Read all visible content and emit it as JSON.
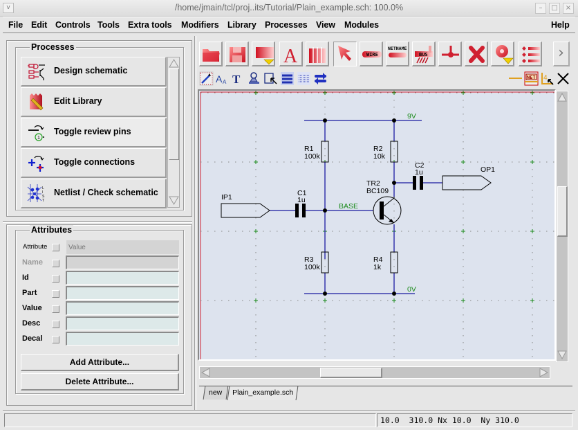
{
  "window": {
    "title": "/home/jmain/tcl/proj..its/Tutorial/Plain_example.sch: 100.0%",
    "menu_glyph": "v",
    "minimize": "–",
    "maximize": "□",
    "close": "×"
  },
  "menubar": {
    "items": [
      "File",
      "Edit",
      "Controls",
      "Tools",
      "Extra tools",
      "Modifiers",
      "Library",
      "Processes",
      "View",
      "Modules"
    ],
    "help": "Help"
  },
  "processes": {
    "title": "Processes",
    "items": [
      {
        "label": "Design schematic",
        "icon": "schematic-icon"
      },
      {
        "label": "Edit Library",
        "icon": "library-edit-icon"
      },
      {
        "label": "Toggle review pins",
        "icon": "review-pins-icon"
      },
      {
        "label": "Toggle connections",
        "icon": "connections-icon"
      },
      {
        "label": "Netlist / Check schematic",
        "icon": "netlist-icon"
      }
    ]
  },
  "attributes": {
    "title": "Attributes",
    "header_label": "Attribute",
    "header_value_placeholder": "Value",
    "rows": [
      {
        "label": "Name",
        "value": "",
        "enabled": false
      },
      {
        "label": "Id",
        "value": "",
        "enabled": true
      },
      {
        "label": "Part",
        "value": "",
        "enabled": true
      },
      {
        "label": "Value",
        "value": "",
        "enabled": true
      },
      {
        "label": "Desc",
        "value": "",
        "enabled": true
      },
      {
        "label": "Decal",
        "value": "",
        "enabled": true
      }
    ],
    "add_button": "Add Attribute...",
    "delete_button": "Delete Attribute..."
  },
  "toolbar": {
    "main_tools": [
      "open-icon",
      "save-icon",
      "place-component-icon",
      "text-icon",
      "library-icon",
      "select-pointer-icon",
      "wire-icon",
      "netname-icon",
      "bus-icon",
      "junction-icon",
      "delete-icon",
      "zoom-icon",
      "list-icon"
    ],
    "wire_label": "WIRE",
    "netname_label": "NETNAME",
    "bus_label": "BUS",
    "more_glyph": "›",
    "small_tools": [
      "magic-wand-icon",
      "font-size-icon",
      "text-tool-icon",
      "stamp-icon",
      "select-area-icon",
      "thick-line-icon",
      "dotted-line-icon",
      "swap-arrows-icon"
    ],
    "right_tools": [
      "line-color-icon",
      "net-highlight-icon",
      "pin-number-icon",
      "cancel-x-icon"
    ],
    "net_label": "NET"
  },
  "schematic": {
    "nets": {
      "top": "9V",
      "bottom": "0V",
      "base": "BASE"
    },
    "ports": {
      "input": "IP1",
      "output": "OP1"
    },
    "components": {
      "R1": {
        "ref": "R1",
        "value": "100k"
      },
      "R2": {
        "ref": "R2",
        "value": "10k"
      },
      "R3": {
        "ref": "R3",
        "value": "100k"
      },
      "R4": {
        "ref": "R4",
        "value": "1k"
      },
      "C1": {
        "ref": "C1",
        "value": "1u"
      },
      "C2": {
        "ref": "C2",
        "value": "1u"
      },
      "TR2": {
        "ref": "TR2",
        "value": "BC109"
      }
    },
    "colors": {
      "wire": "#1a1aa0",
      "net_label": "#1a8a1a",
      "component": "#000000",
      "border": "#d02030",
      "background": "#dde3ee"
    }
  },
  "tabs": [
    {
      "label": "new",
      "active": false
    },
    {
      "label": "Plain_example.sch",
      "active": true
    }
  ],
  "status": {
    "message": "",
    "coordinates": "10.0  310.0 Nx 10.0  Ny 310.0"
  }
}
